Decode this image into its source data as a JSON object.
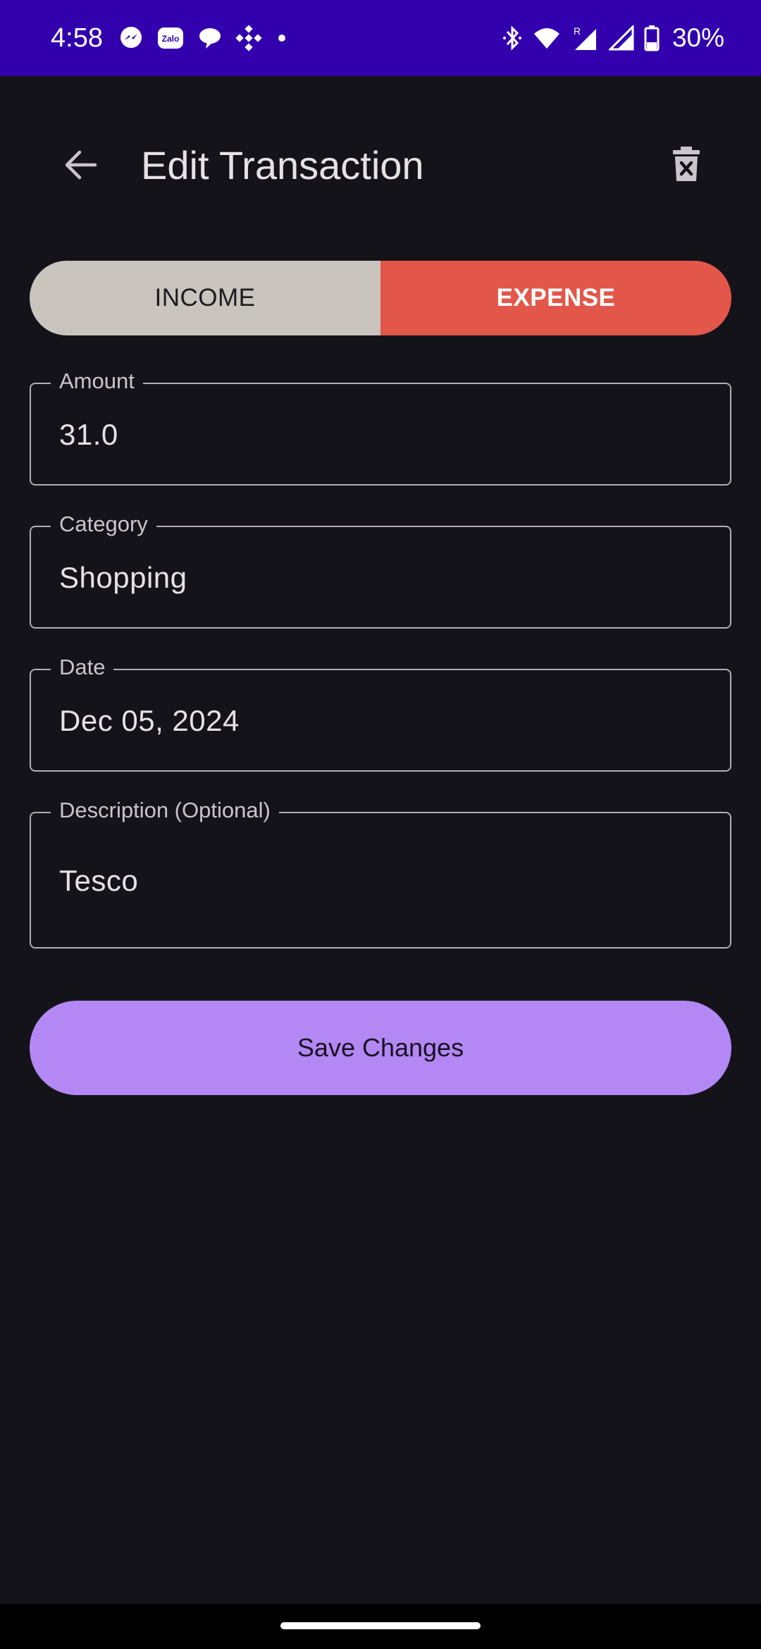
{
  "status_bar": {
    "time": "4:58",
    "battery": "30%",
    "notification_icons": [
      "messenger-icon",
      "zalo-icon",
      "chat-bubble-icon",
      "binance-icon",
      "dot-icon"
    ],
    "system_icons": [
      "bluetooth-icon",
      "wifi-icon",
      "signal-roaming-icon",
      "signal-icon",
      "battery-icon"
    ],
    "zalo_text": "Zalo"
  },
  "app_bar": {
    "title": "Edit Transaction",
    "back_icon": "arrow-back-icon",
    "delete_icon": "delete-icon"
  },
  "type_toggle": {
    "income_label": "INCOME",
    "expense_label": "EXPENSE",
    "selected": "EXPENSE",
    "colors": {
      "income_bg": "#cac4bf",
      "expense_bg": "#e2574a"
    }
  },
  "form": {
    "amount": {
      "label": "Amount",
      "value": "31.0"
    },
    "category": {
      "label": "Category",
      "value": "Shopping"
    },
    "date": {
      "label": "Date",
      "value": "Dec 05, 2024"
    },
    "description": {
      "label": "Description (Optional)",
      "value": "Tesco"
    }
  },
  "actions": {
    "save_label": "Save Changes",
    "save_color": "#b388f4"
  },
  "theme": {
    "background": "#141319",
    "status_bar_bg": "#3200ad"
  }
}
